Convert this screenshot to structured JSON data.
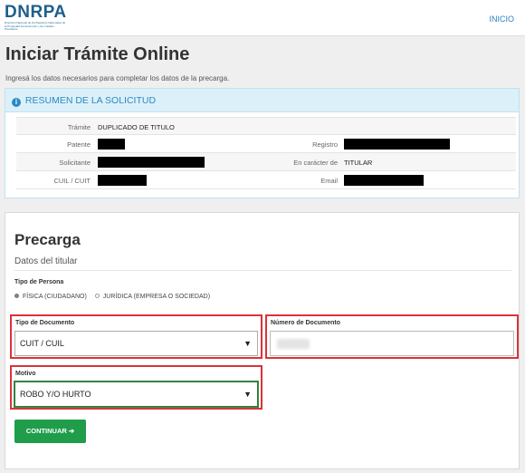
{
  "header": {
    "logo_title": "DNRPA",
    "logo_subtitle": "Dirección Nacional de los Registros Nacionales de la Propiedad del Automotor y de Créditos Prendarios",
    "nav_inicio": "INICIO"
  },
  "page": {
    "title": "Iniciar Trámite Online",
    "intro": "Ingresá los datos necesarios para completar los datos de la precarga."
  },
  "summary": {
    "heading": "RESUMEN DE LA SOLICITUD",
    "info_icon": "info-icon",
    "rows": [
      {
        "label1": "Trámite",
        "value1": "DUPLICADO DE TITULO",
        "label2": "",
        "value2": ""
      },
      {
        "label1": "Patente",
        "value1": "",
        "label2": "Registro",
        "value2": ""
      },
      {
        "label1": "Solicitante",
        "value1": "",
        "label2": "En carácter de",
        "value2": "TITULAR"
      },
      {
        "label1": "CUIL / CUIT",
        "value1": "",
        "label2": "Email",
        "value2": ""
      }
    ]
  },
  "precarga": {
    "title": "Precarga",
    "subtitle": "Datos del titular",
    "tipo_persona_label": "Tipo de Persona",
    "tipo_persona_options": [
      "FÍSICA (CIUDADANO)",
      "JURÍDICA (EMPRESA O SOCIEDAD)"
    ],
    "tipo_documento_label": "Tipo de Documento",
    "tipo_documento_value": "CUIT / CUIL",
    "numero_documento_label": "Número de Documento",
    "numero_documento_value": "",
    "motivo_label": "Motivo",
    "motivo_value": "ROBO Y/O HURTO",
    "continue_label": "CONTINUAR ➔"
  },
  "colors": {
    "brand": "#1d5f8c",
    "info": "#2a8ac3",
    "highlight": "#d9333a",
    "button": "#1f9d4b"
  }
}
